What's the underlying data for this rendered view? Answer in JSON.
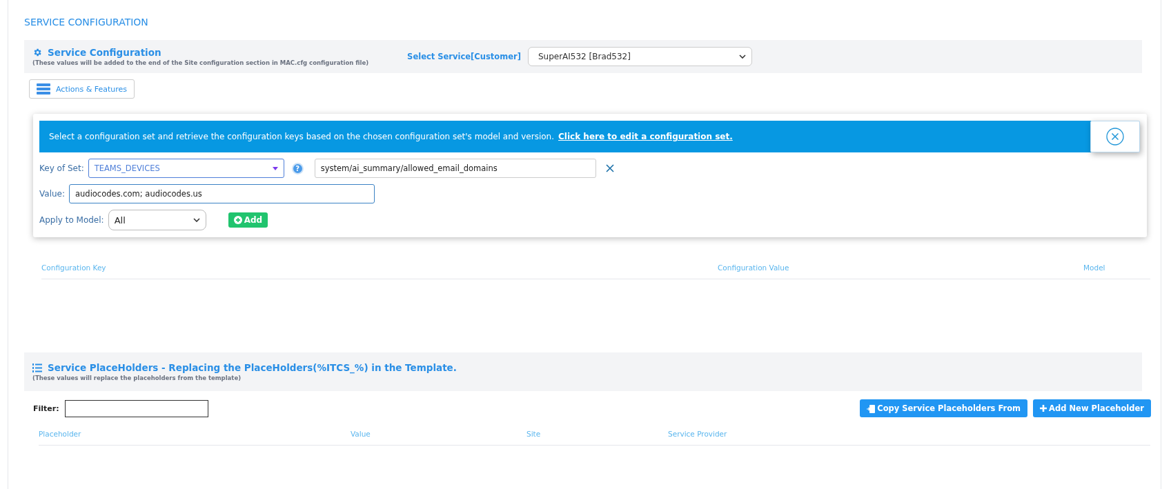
{
  "page_title": "SERVICE CONFIGURATION",
  "service_section": {
    "title": "Service Configuration",
    "subtitle": "(These values will be added to the end of the Site configuration section in MAC.cfg configuration file)",
    "select_label": "Select Service[Customer]",
    "select_value": "SuperAI532 [Brad532]"
  },
  "actions_button": "Actions & Features",
  "config_panel": {
    "banner_text": "Select a configuration set and retrieve the configuration keys based on the chosen configuration set's model and version.",
    "banner_link": "Click here to edit a configuration set.",
    "key_of_set_label": "Key of Set:",
    "key_of_set_value": "TEAMS_DEVICES",
    "help_icon": "?",
    "key_value": "system/ai_summary/allowed_email_domains",
    "value_label": "Value:",
    "value": "audiocodes.com; audiocodes.us",
    "apply_label": "Apply to Model:",
    "apply_value": "All",
    "add_button": "Add"
  },
  "config_table": {
    "columns": [
      "Configuration Key",
      "Configuration Value",
      "Model"
    ]
  },
  "placeholder_section": {
    "title": "Service PlaceHolders - Replacing the PlaceHolders(%ITCS_%) in the Template.",
    "subtitle": "(These values will replace the placeholders from the template)",
    "filter_label": "Filter:",
    "buttons": [
      {
        "kind": "copy",
        "label": "Copy Service Placeholders From"
      },
      {
        "kind": "add",
        "label": "Add New Placeholder"
      }
    ],
    "columns": [
      "Placeholder",
      "Value",
      "Site",
      "Service Provider"
    ]
  }
}
